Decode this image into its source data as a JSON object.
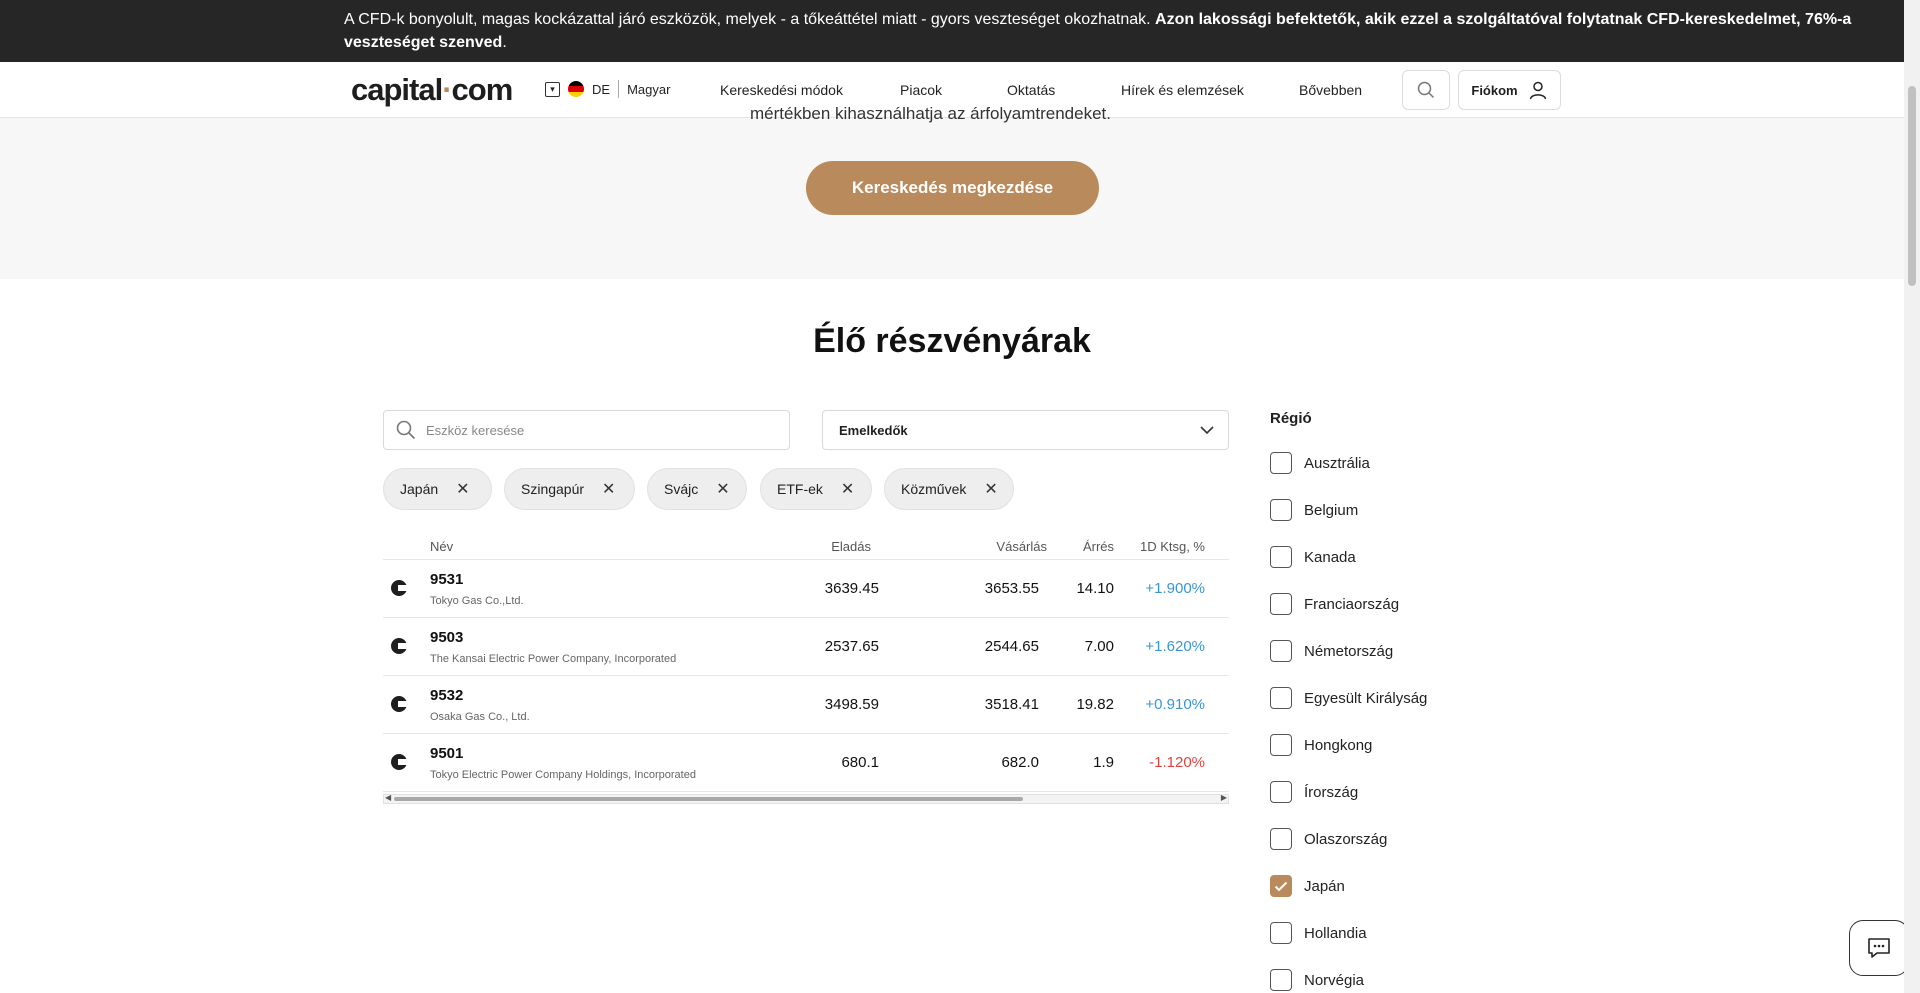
{
  "risk_banner": {
    "text": "A CFD-k bonyolult, magas kockázattal járó eszközök, melyek - a tőkeáttétel miatt - gyors veszteséget okozhatnak. ",
    "bold": "Azon lakossági befektetők, akik ezzel a szolgáltatóval folytatnak CFD-kereskedelmet, 76%-a veszteséget szenved",
    "end": "."
  },
  "header": {
    "logo_left": "capital",
    "logo_dot": "·",
    "logo_right": "com",
    "region": "DE",
    "language": "Magyar",
    "nav": [
      "Kereskedési módok",
      "Piacok",
      "Oktatás",
      "Hírek és elemzések",
      "Bővebben"
    ],
    "account_label": "Fiókom"
  },
  "hero": {
    "partial_text": "mértékben kihasználhatja az árfolyamtrendeket.",
    "cta_label": "Kereskedés megkezdése"
  },
  "section_title": "Élő részvényárak",
  "search": {
    "placeholder": "Eszköz keresése"
  },
  "sort": {
    "selected": "Emelkedők"
  },
  "filters": [
    "Japán",
    "Szingapúr",
    "Svájc",
    "ETF-ek",
    "Közművek"
  ],
  "table": {
    "columns": {
      "name": "Név",
      "sell": "Eladás",
      "buy": "Vásárlás",
      "spread": "Árrés",
      "change": "1D Ktsg, %"
    },
    "rows": [
      {
        "symbol": "9531",
        "company": "Tokyo Gas Co.,Ltd.",
        "sell": "3639.45",
        "buy": "3653.55",
        "spread": "14.10",
        "change": "+1.900%",
        "trend": "up"
      },
      {
        "symbol": "9503",
        "company": "The Kansai Electric Power Company, Incorporated",
        "sell": "2537.65",
        "buy": "2544.65",
        "spread": "7.00",
        "change": "+1.620%",
        "trend": "up"
      },
      {
        "symbol": "9532",
        "company": "Osaka Gas Co., Ltd.",
        "sell": "3498.59",
        "buy": "3518.41",
        "spread": "19.82",
        "change": "+0.910%",
        "trend": "up"
      },
      {
        "symbol": "9501",
        "company": "Tokyo Electric Power Company Holdings, Incorporated",
        "sell": "680.1",
        "buy": "682.0",
        "spread": "1.9",
        "change": "-1.120%",
        "trend": "down"
      }
    ]
  },
  "region_filter": {
    "title": "Régió",
    "items": [
      {
        "label": "Ausztrália",
        "checked": false
      },
      {
        "label": "Belgium",
        "checked": false
      },
      {
        "label": "Kanada",
        "checked": false
      },
      {
        "label": "Franciaország",
        "checked": false
      },
      {
        "label": "Németország",
        "checked": false
      },
      {
        "label": "Egyesült Királyság",
        "checked": false
      },
      {
        "label": "Hongkong",
        "checked": false
      },
      {
        "label": "Írország",
        "checked": false
      },
      {
        "label": "Olaszország",
        "checked": false
      },
      {
        "label": "Japán",
        "checked": true
      },
      {
        "label": "Hollandia",
        "checked": false
      },
      {
        "label": "Norvégia",
        "checked": false
      }
    ]
  },
  "colors": {
    "accent": "#b98a5c",
    "positive": "#3a96d3",
    "negative": "#e0433e",
    "banner_bg": "#262626"
  },
  "icons": {
    "search": "search-icon",
    "account": "user-icon",
    "chat": "chat-icon",
    "chevron": "chevron-down-icon",
    "remove": "close-icon",
    "check": "check-icon"
  }
}
